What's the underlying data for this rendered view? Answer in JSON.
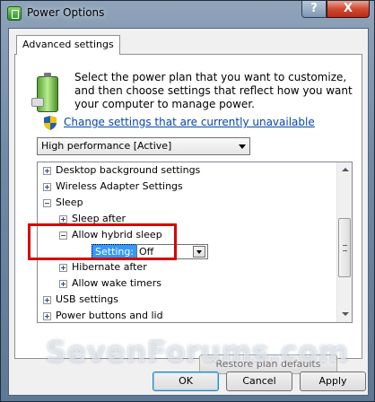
{
  "window": {
    "title": "Power Options",
    "help_label": "?",
    "close_label": "X"
  },
  "tab": {
    "label": "Advanced settings"
  },
  "intro": {
    "text": "Select the power plan that you want to customize, and then choose settings that reflect how you want your computer to manage power."
  },
  "link": {
    "text": "Change settings that are currently unavailable"
  },
  "plan_select": {
    "value": "High performance [Active]"
  },
  "tree": {
    "items": [
      {
        "label": "Desktop background settings"
      },
      {
        "label": "Wireless Adapter Settings"
      },
      {
        "label": "Sleep"
      },
      {
        "label": "Sleep after"
      },
      {
        "label": "Allow hybrid sleep"
      },
      {
        "label": "Hibernate after"
      },
      {
        "label": "Allow wake timers"
      },
      {
        "label": "USB settings"
      },
      {
        "label": "Power buttons and lid"
      }
    ],
    "setting_label": "Setting:",
    "setting_value": "Off"
  },
  "buttons": {
    "restore": "Restore plan defaults",
    "ok": "OK",
    "cancel": "Cancel",
    "apply": "Apply"
  },
  "watermark": "SevenForums.com",
  "colors": {
    "link": "#0645ad",
    "highlight_box": "#d80000",
    "selection": "#3399ff"
  }
}
